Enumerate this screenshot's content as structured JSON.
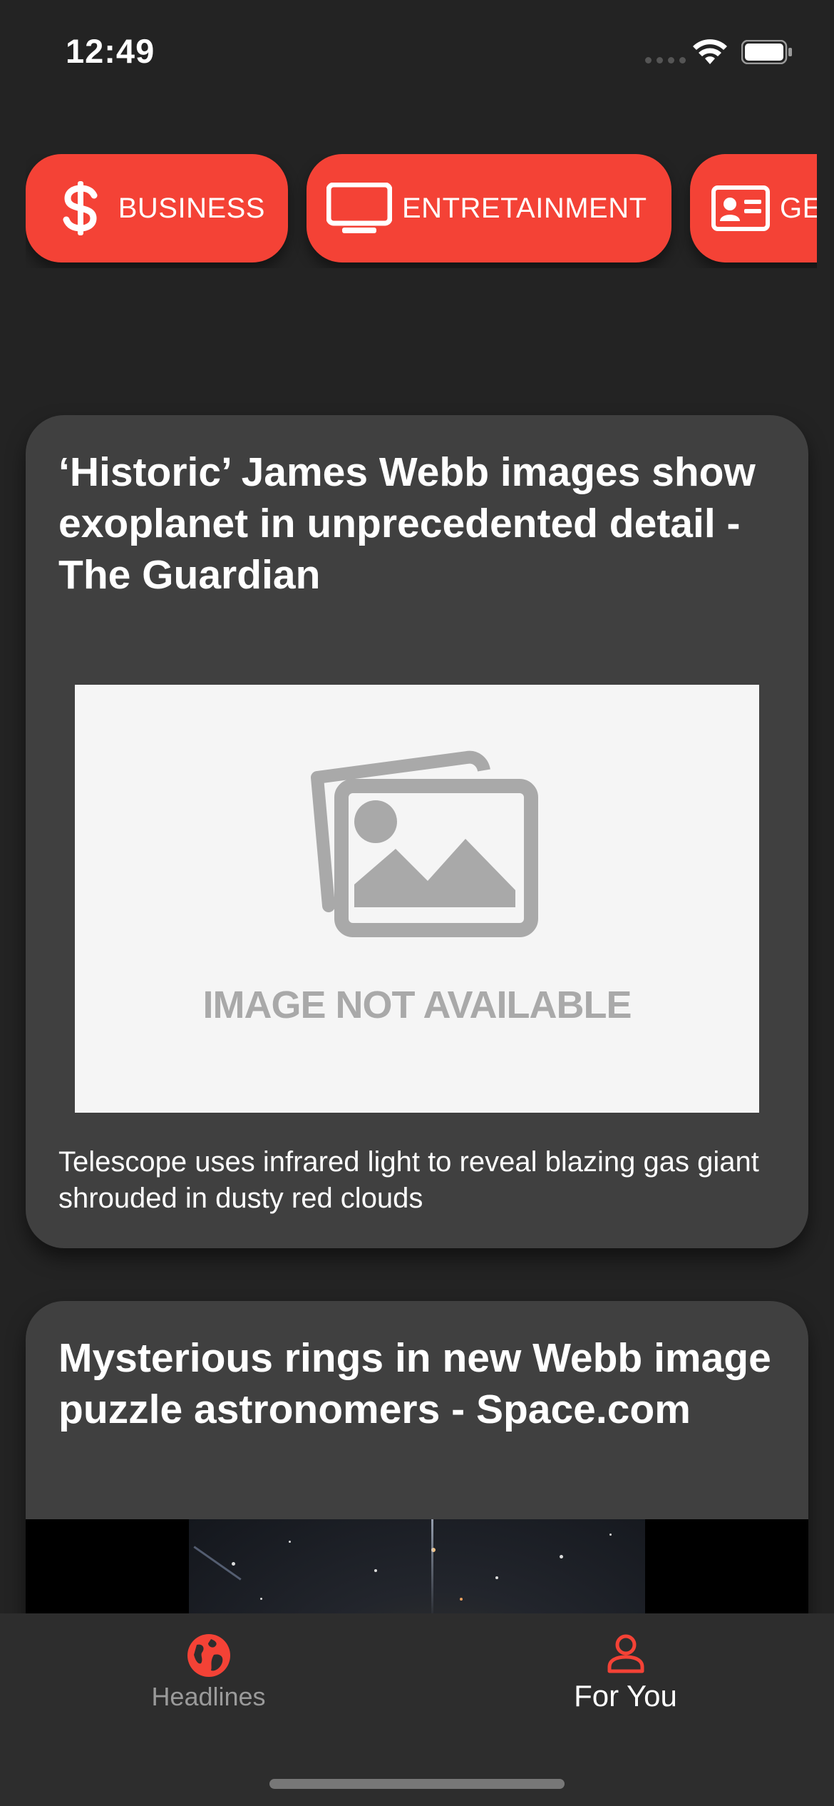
{
  "status_bar": {
    "time": "12:49"
  },
  "categories": [
    {
      "label": "BUSINESS",
      "icon": "dollar-icon"
    },
    {
      "label": "ENTRETAINMENT",
      "icon": "tv-icon"
    },
    {
      "label": "GE",
      "icon": "id-card-icon"
    }
  ],
  "articles": [
    {
      "title": "‘Historic’ James Webb images show exoplanet in unprecedented detail - The Guardian",
      "image_placeholder_text": "IMAGE NOT AVAILABLE",
      "description": "Telescope uses infrared light to reveal blazing gas giant shrouded in dusty red clouds"
    },
    {
      "title": "Mysterious rings in new Webb image puzzle astronomers - Space.com"
    }
  ],
  "tab_bar": {
    "tabs": [
      {
        "label": "Headlines",
        "icon": "globe-icon",
        "selected": false
      },
      {
        "label": "For You",
        "icon": "person-icon",
        "selected": true
      }
    ]
  },
  "colors": {
    "accent": "#f44236",
    "background": "#232323",
    "card": "#404040",
    "tab_bar": "#2d2d2d"
  }
}
